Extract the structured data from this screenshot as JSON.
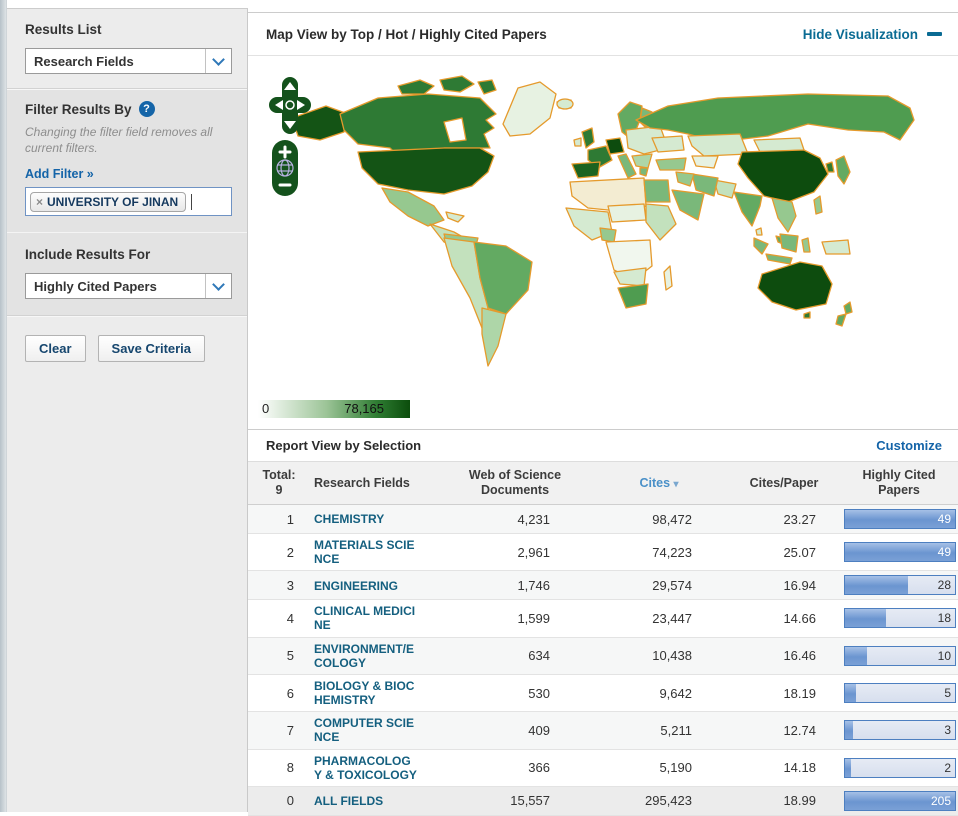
{
  "sidebar": {
    "results_list_label": "Results List",
    "results_list_value": "Research Fields",
    "filter_title": "Filter Results By",
    "filter_help_icon": "?",
    "filter_note": "Changing the filter field removes all current filters.",
    "add_filter_label": "Add Filter »",
    "chip_remove_icon": "×",
    "chip_label": "UNIVERSITY OF JINAN",
    "include_label": "Include Results For",
    "include_value": "Highly Cited Papers",
    "clear_button": "Clear",
    "save_button": "Save Criteria"
  },
  "map_panel": {
    "title": "Map View by Top / Hot / Highly Cited Papers",
    "hide_link_label": "Hide Visualization",
    "legend_min": "0",
    "legend_max": "78,165",
    "zoom_in_label": "+",
    "zoom_out_label": "−",
    "palette": {
      "noData": "#f3ecd2",
      "g0": "#f1f7ee",
      "g1": "#e7f2e2",
      "g2": "#d5ead1",
      "g3": "#c3e1bd",
      "g4": "#aed6a8",
      "g5": "#96c88f",
      "g6": "#7ab87a",
      "g7": "#63aa62",
      "g8": "#4f9c50",
      "g9": "#2e7a34",
      "g10": "#1c6320",
      "g11": "#145415",
      "g12": "#0d4c0e",
      "border": "#e59a2c",
      "control": "#14521c",
      "globe": "#b9b2e2"
    }
  },
  "report": {
    "title": "Report View by Selection",
    "customize_label": "Customize",
    "header": {
      "total_line1": "Total:",
      "total_line2": "9",
      "field": "Research Fields",
      "docs": "Web of Science Documents",
      "cites": "Cites",
      "sort_indicator": "▾",
      "cpp": "Cites/Paper",
      "hcp": "Highly Cited Papers"
    },
    "rows": [
      {
        "rank": "1",
        "field": "CHEMISTRY",
        "docs": "4,231",
        "cites": "98,472",
        "cpp": "23.27",
        "hcp": "49",
        "bar_pct": 100
      },
      {
        "rank": "2",
        "field": "MATERIALS SCIENCE",
        "docs": "2,961",
        "cites": "74,223",
        "cpp": "25.07",
        "hcp": "49",
        "bar_pct": 100
      },
      {
        "rank": "3",
        "field": "ENGINEERING",
        "docs": "1,746",
        "cites": "29,574",
        "cpp": "16.94",
        "hcp": "28",
        "bar_pct": 57
      },
      {
        "rank": "4",
        "field": "CLINICAL MEDICINE",
        "docs": "1,599",
        "cites": "23,447",
        "cpp": "14.66",
        "hcp": "18",
        "bar_pct": 37
      },
      {
        "rank": "5",
        "field": "ENVIRONMENT/ECOLOGY",
        "docs": "634",
        "cites": "10,438",
        "cpp": "16.46",
        "hcp": "10",
        "bar_pct": 20
      },
      {
        "rank": "6",
        "field": "BIOLOGY & BIOCHEMISTRY",
        "docs": "530",
        "cites": "9,642",
        "cpp": "18.19",
        "hcp": "5",
        "bar_pct": 10
      },
      {
        "rank": "7",
        "field": "COMPUTER SCIENCE",
        "docs": "409",
        "cites": "5,211",
        "cpp": "12.74",
        "hcp": "3",
        "bar_pct": 7
      },
      {
        "rank": "8",
        "field": "PHARMACOLOGY & TOXICOLOGY",
        "docs": "366",
        "cites": "5,190",
        "cpp": "14.18",
        "hcp": "2",
        "bar_pct": 5
      },
      {
        "rank": "0",
        "field": "ALL FIELDS",
        "docs": "15,557",
        "cites": "295,423",
        "cpp": "18.99",
        "hcp": "205",
        "bar_pct": 100,
        "total_row": true
      }
    ]
  }
}
